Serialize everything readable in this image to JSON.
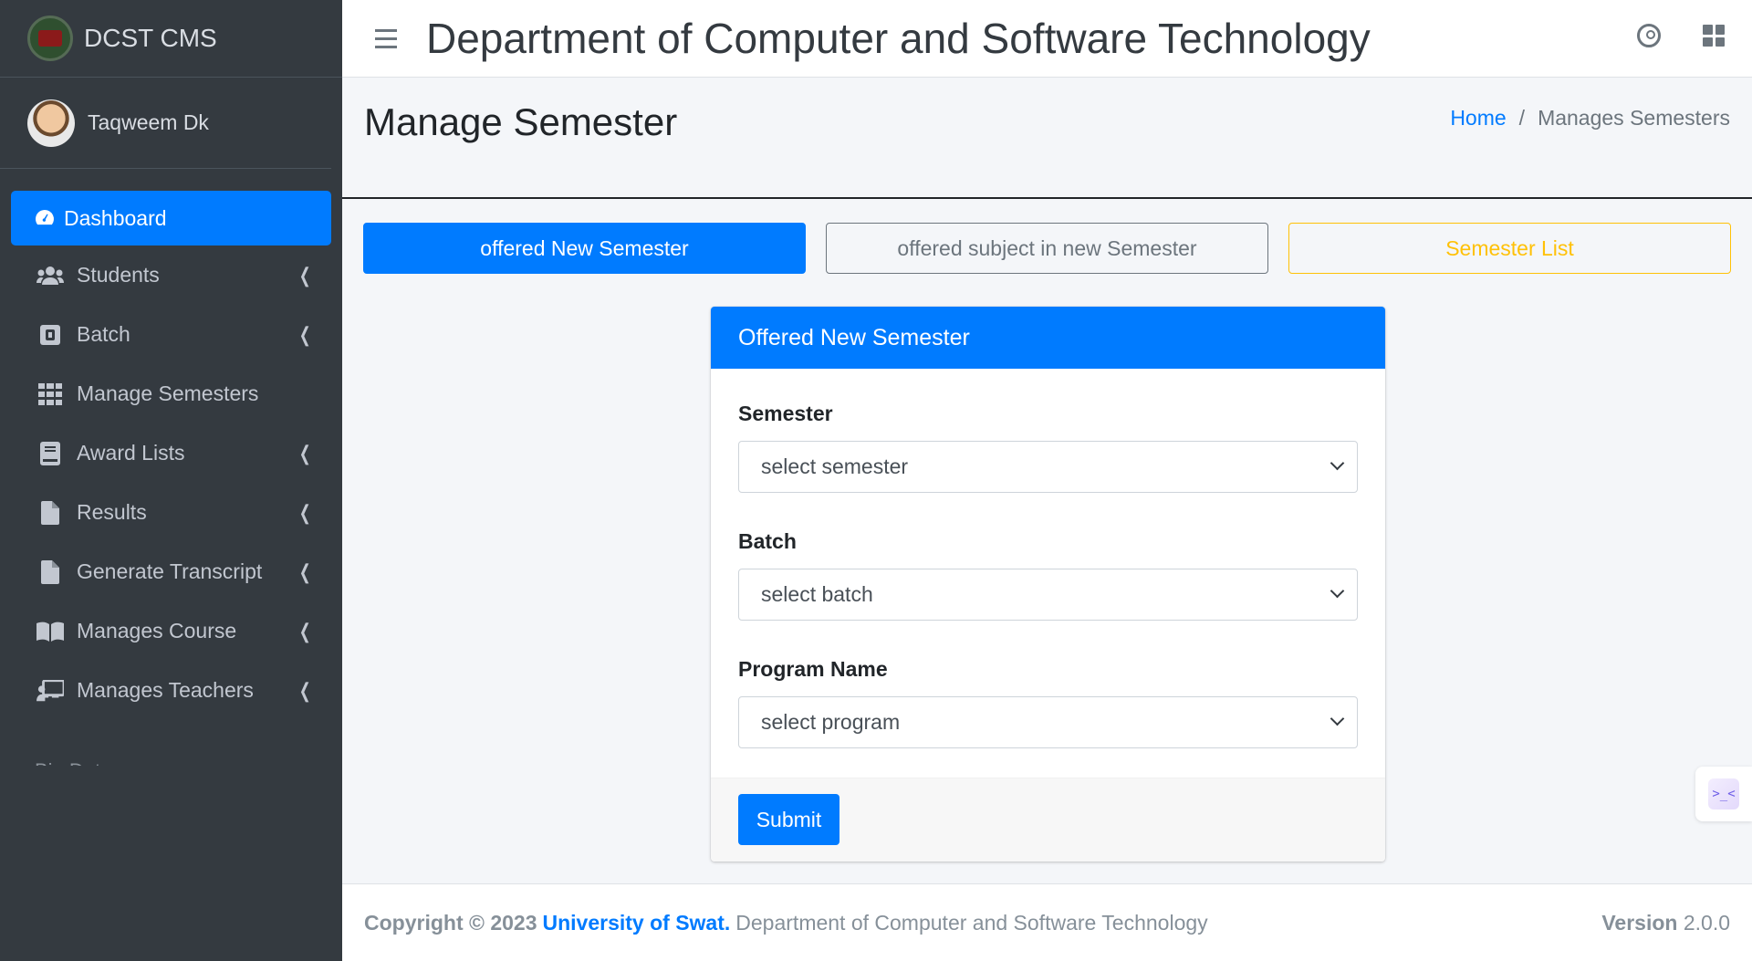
{
  "brand": {
    "name": "DCST CMS",
    "logo_icon": "university-seal-icon"
  },
  "user": {
    "name": "Taqweem Dk",
    "avatar_icon": "user-avatar"
  },
  "sidebar": {
    "items": [
      {
        "label": "Dashboard",
        "icon": "tachometer-icon",
        "active": true,
        "has_children": false
      },
      {
        "label": "Students",
        "icon": "users-icon",
        "active": false,
        "has_children": true
      },
      {
        "label": "Batch",
        "icon": "bold-square-icon",
        "active": false,
        "has_children": true
      },
      {
        "label": "Manage Semesters",
        "icon": "grid-icon",
        "active": false,
        "has_children": false
      },
      {
        "label": "Award Lists",
        "icon": "book-icon",
        "active": false,
        "has_children": true
      },
      {
        "label": "Results",
        "icon": "file-icon",
        "active": false,
        "has_children": true
      },
      {
        "label": "Generate Transcript",
        "icon": "file-icon",
        "active": false,
        "has_children": true
      },
      {
        "label": "Manages Course",
        "icon": "open-book-icon",
        "active": false,
        "has_children": true
      },
      {
        "label": "Manages Teachers",
        "icon": "chalkboard-teacher-icon",
        "active": false,
        "has_children": true
      }
    ],
    "partial_next_label": "Bio Data"
  },
  "topbar": {
    "title": "Department of Computer and Software Technology",
    "menu_icon": "hamburger-icon",
    "right_icons": [
      "user-circle-icon",
      "th-large-icon"
    ]
  },
  "content_header": {
    "title": "Manage Semester",
    "breadcrumb": {
      "home": "Home",
      "separator": "/",
      "current": "Manages Semesters"
    }
  },
  "tabs": {
    "offered_new": "offered New Semester",
    "offered_subject": "offered subject in new Semester",
    "semester_list": "Semester List"
  },
  "form": {
    "header": "Offered New Semester",
    "semester_label": "Semester",
    "semester_value": "select semester",
    "batch_label": "Batch",
    "batch_value": "select batch",
    "program_label": "Program Name",
    "program_value": "select program",
    "submit": "Submit"
  },
  "footer": {
    "copyright": "Copyright © 2023",
    "university": "University of Swat.",
    "department": "Department of Computer and Software Technology",
    "version_label": "Version",
    "version_value": "2.0.0"
  },
  "colors": {
    "primary": "#007bff",
    "sidebar_bg": "#343a40",
    "warning": "#ffc107",
    "secondary": "#6c757d"
  }
}
